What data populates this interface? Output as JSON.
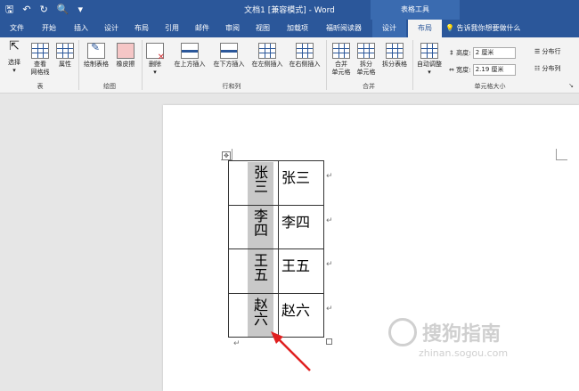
{
  "title_bar": {
    "doc_title": "文档1 [兼容模式] - Word",
    "context_group": "表格工具",
    "qat": [
      "save-icon",
      "undo-icon",
      "redo-icon",
      "print-preview-icon",
      "customize-icon"
    ]
  },
  "tabs": [
    {
      "label": "文件"
    },
    {
      "label": "开始"
    },
    {
      "label": "插入"
    },
    {
      "label": "设计"
    },
    {
      "label": "布局"
    },
    {
      "label": "引用"
    },
    {
      "label": "邮件"
    },
    {
      "label": "审阅"
    },
    {
      "label": "视图"
    },
    {
      "label": "加载项"
    },
    {
      "label": "福昕阅读器"
    },
    {
      "label": "设计"
    },
    {
      "label": "布局"
    }
  ],
  "tell_me": "告诉我你想要做什么",
  "ribbon": {
    "table_group": {
      "select": "选择",
      "view_grid_1": "查看",
      "view_grid_2": "网格线",
      "properties": "属性",
      "label": "表"
    },
    "draw_group": {
      "draw_table": "绘制表格",
      "eraser": "橡皮擦",
      "label": "绘图"
    },
    "rows_cols_group": {
      "delete": "删除",
      "insert_above": "在上方插入",
      "insert_below": "在下方插入",
      "insert_left": "在左侧插入",
      "insert_right": "在右侧插入",
      "label": "行和列"
    },
    "merge_group": {
      "merge_1": "合并",
      "merge_2": "单元格",
      "split_1": "拆分",
      "split_2": "单元格",
      "split_table": "拆分表格",
      "label": "合并"
    },
    "cell_size_group": {
      "autofit": "自动调整",
      "height_label": "高度:",
      "height_value": "2 厘米",
      "width_label": "宽度:",
      "width_value": "2.19 厘米",
      "distribute_rows": "分布行",
      "distribute_cols": "分布列",
      "label": "单元格大小"
    }
  },
  "table": {
    "col1": [
      "张三",
      "李四",
      "王五",
      "赵六"
    ],
    "col2": [
      "张三",
      "李四",
      "王五",
      "赵六"
    ]
  },
  "watermark": {
    "text": "搜狗指南",
    "url": "zhinan.sogou.com"
  }
}
